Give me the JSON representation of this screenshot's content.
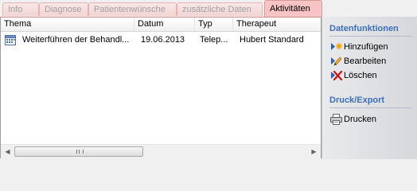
{
  "tabs": [
    {
      "label": "Info",
      "active": false
    },
    {
      "label": "Diagnose",
      "active": false
    },
    {
      "label": "Patientenwünsche",
      "active": false
    },
    {
      "label": "zusätzliche Daten",
      "active": false
    },
    {
      "label": "Aktivitäten",
      "active": true
    }
  ],
  "grid": {
    "columns": [
      "Thema",
      "Datum",
      "Typ",
      "Therapeut"
    ],
    "rows": [
      {
        "thema": "Weiterführen der Behandl...",
        "datum": "19.06.2013",
        "typ": "Telep...",
        "therapeut": "Hubert Standard"
      }
    ],
    "scrollbar": {
      "left_arrow": "◀",
      "right_arrow": "▶"
    }
  },
  "side_panel": {
    "section1_title": "Datenfunktionen",
    "add_label": "Hinzufügen",
    "edit_label": "Bearbeiten",
    "delete_label": "Löschen",
    "section2_title": "Druck/Export",
    "print_label": "Drucken"
  },
  "colors": {
    "active_tab": "#f7c3c3",
    "section_title": "#3c6fb7"
  }
}
